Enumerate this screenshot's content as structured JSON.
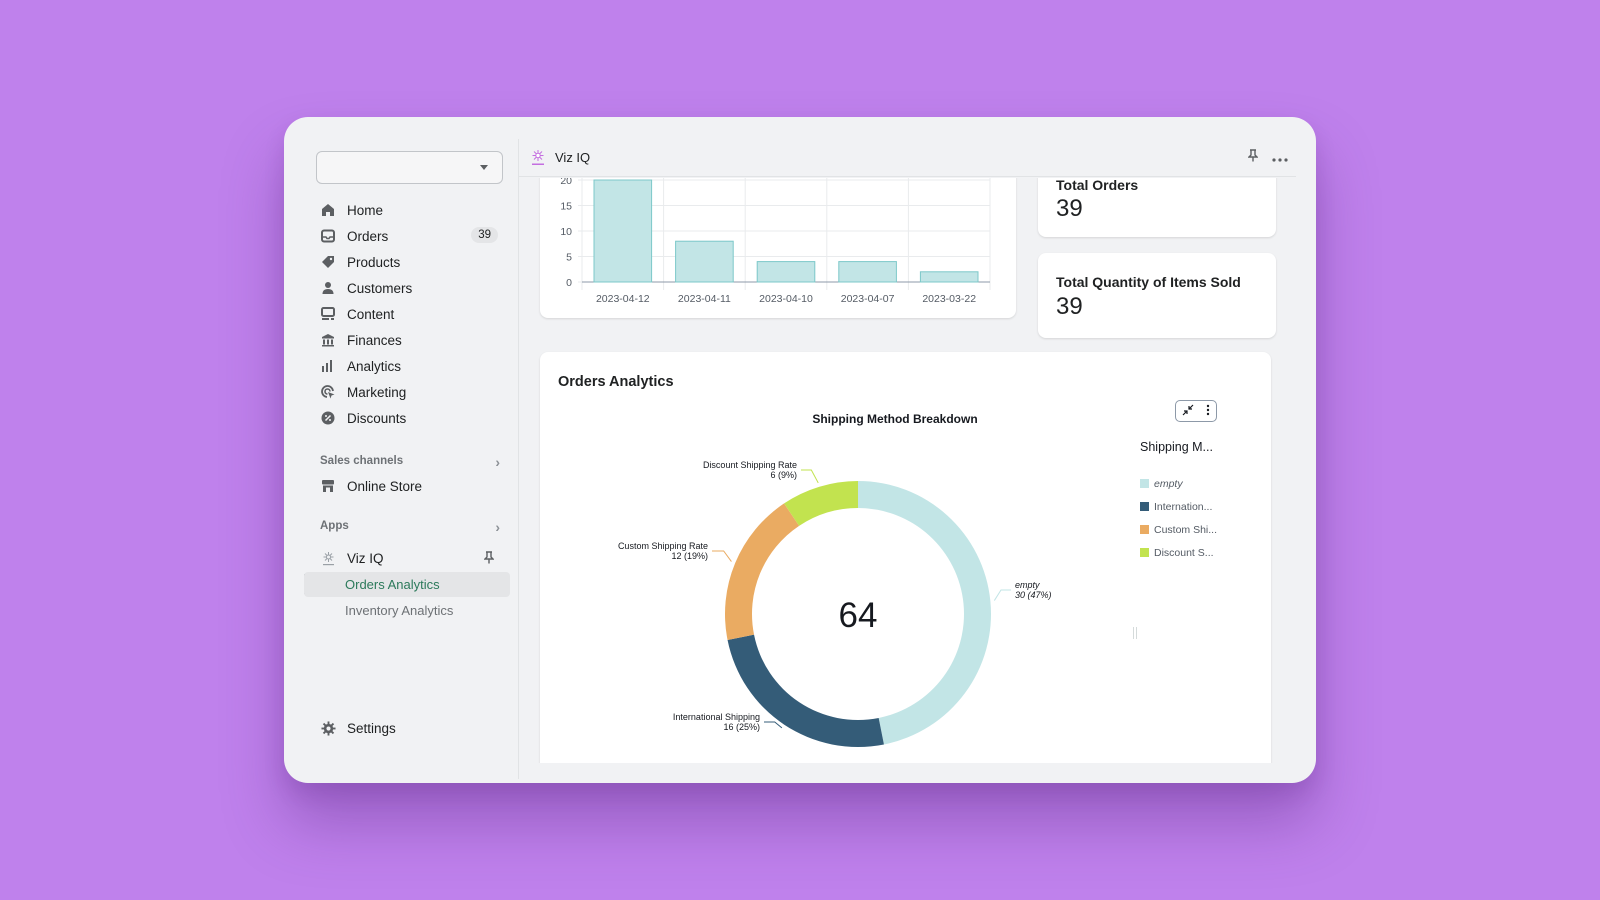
{
  "sidebar": {
    "store_select_value": "",
    "nav": [
      {
        "label": "Home",
        "icon": "home-icon"
      },
      {
        "label": "Orders",
        "icon": "orders-inbox-icon",
        "badge": "39"
      },
      {
        "label": "Products",
        "icon": "tag-icon"
      },
      {
        "label": "Customers",
        "icon": "person-icon"
      },
      {
        "label": "Content",
        "icon": "content-image-icon"
      },
      {
        "label": "Finances",
        "icon": "bank-icon"
      },
      {
        "label": "Analytics",
        "icon": "bar-chart-icon"
      },
      {
        "label": "Marketing",
        "icon": "target-cursor-icon"
      },
      {
        "label": "Discounts",
        "icon": "discount-percent-icon"
      }
    ],
    "sales_channels": {
      "heading": "Sales channels",
      "items": [
        {
          "label": "Online Store",
          "icon": "store-icon"
        }
      ]
    },
    "apps": {
      "heading": "Apps",
      "app": {
        "label": "Viz IQ",
        "icon": "viz-iq-logo-icon"
      },
      "sub_items": [
        {
          "label": "Orders Analytics",
          "active": true
        },
        {
          "label": "Inventory Analytics",
          "active": false
        }
      ]
    },
    "settings_label": "Settings"
  },
  "header": {
    "app_title": "Viz IQ",
    "pin_icon": "pin-icon",
    "more_icon": "more-horizontal-icon"
  },
  "stats": [
    {
      "label": "Total Orders",
      "value": "39"
    },
    {
      "label": "Total Quantity of Items Sold",
      "value": "39"
    }
  ],
  "analytics": {
    "card_title": "Orders Analytics",
    "tool_icons": [
      "collapse-arrows-icon",
      "more-vertical-icon"
    ]
  },
  "colors": {
    "accent_green": "#2c7a5b",
    "bar_fill": "#c2e5e6",
    "bar_stroke": "#7cc8c9",
    "donut": [
      "#c2e5e6",
      "#345c78",
      "#eaab62",
      "#c2e34f"
    ]
  },
  "chart_data": [
    {
      "type": "bar",
      "title": "",
      "categories": [
        "2023-04-12",
        "2023-04-11",
        "2023-04-10",
        "2023-04-07",
        "2023-03-22"
      ],
      "values": [
        20,
        8,
        4,
        4,
        2
      ],
      "xlabel": "",
      "ylabel": "",
      "yticks": [
        0,
        5,
        10,
        15,
        20
      ],
      "visible_ytick_labels": [
        "0",
        "5",
        "10",
        "15"
      ],
      "ylim": [
        0,
        20
      ],
      "grid": true
    },
    {
      "type": "pie",
      "title": "Shipping Method Breakdown",
      "donut": true,
      "center_label": "64",
      "legend_title": "Shipping M...",
      "legend_position": "right",
      "slices": [
        {
          "name": "empty",
          "legend": "empty",
          "value": 30,
          "percent": "47%",
          "label": "30 (47%)"
        },
        {
          "name": "International Shipping",
          "legend": "Internation...",
          "value": 16,
          "percent": "25%",
          "label": "16 (25%)"
        },
        {
          "name": "Custom Shipping Rate",
          "legend": "Custom Shi...",
          "value": 12,
          "percent": "19%",
          "label": "12 (19%)"
        },
        {
          "name": "Discount Shipping Rate",
          "legend": "Discount S...",
          "value": 6,
          "percent": "9%",
          "label": "6 (9%)"
        }
      ]
    }
  ]
}
